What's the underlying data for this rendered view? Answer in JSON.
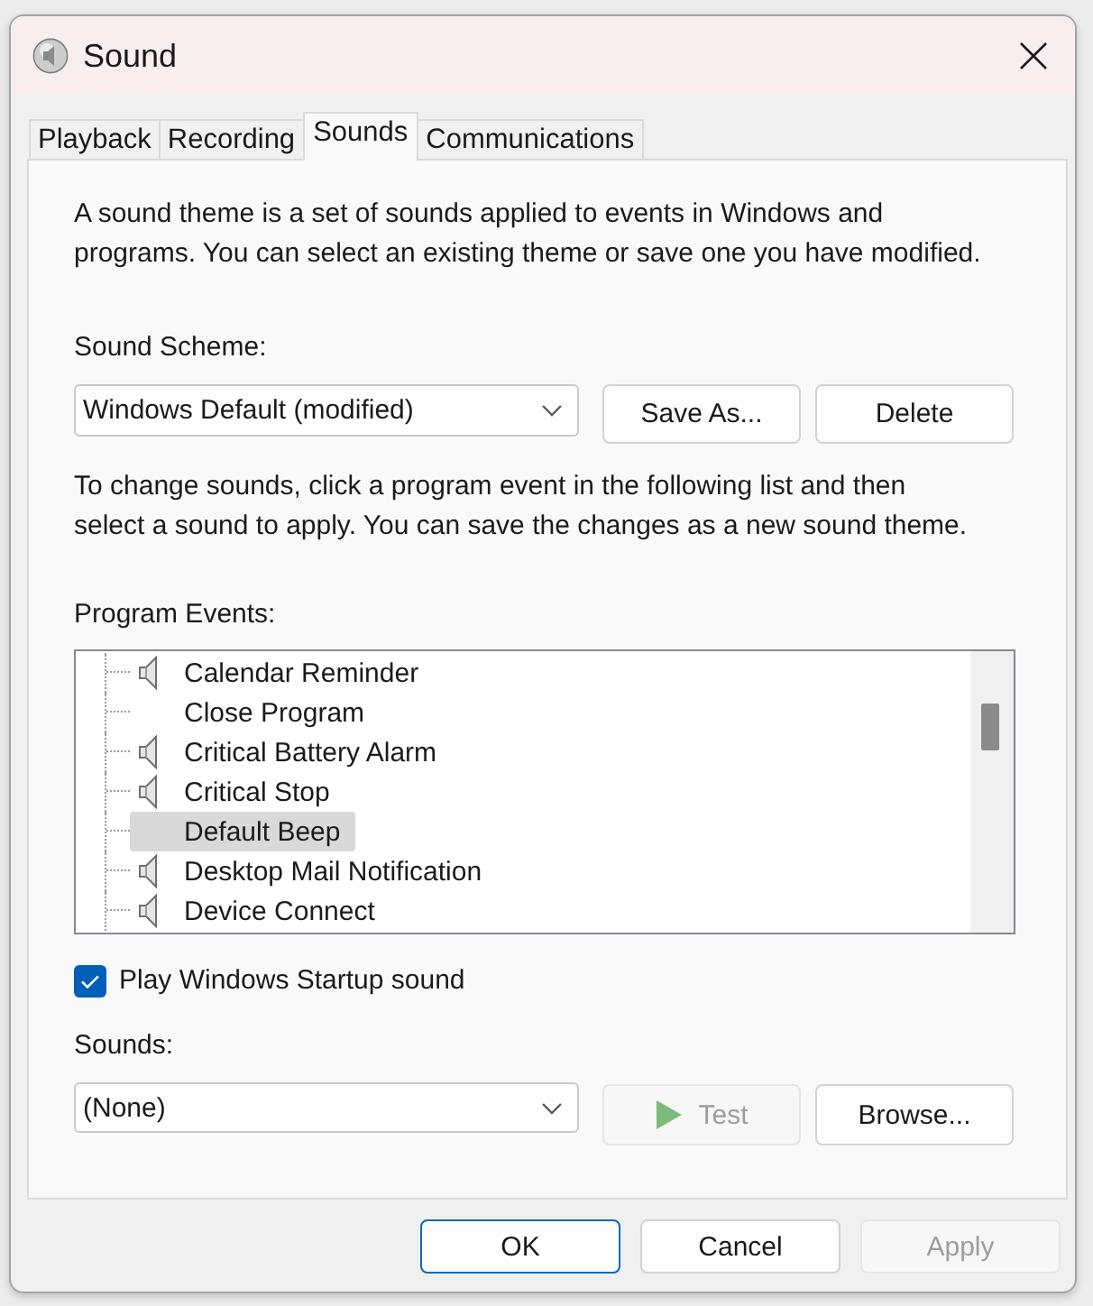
{
  "window": {
    "title": "Sound"
  },
  "tabs": [
    {
      "label": "Playback",
      "selected": false
    },
    {
      "label": "Recording",
      "selected": false
    },
    {
      "label": "Sounds",
      "selected": true
    },
    {
      "label": "Communications",
      "selected": false
    }
  ],
  "description": "A sound theme is a set of sounds applied to events in Windows and programs. You can select an existing theme or save one you have modified.",
  "sound_scheme": {
    "label": "Sound Scheme:",
    "value": "Windows Default (modified)"
  },
  "scheme_buttons": [
    {
      "label": "Save As...",
      "disabled": false
    },
    {
      "label": "Delete",
      "disabled": false
    }
  ],
  "instructions": "To change sounds, click a program event in the following list and then select a sound to apply. You can save the changes as a new sound theme.",
  "program_events": {
    "label": "Program Events:",
    "items": [
      {
        "name": "Calendar Reminder",
        "has_sound": true,
        "selected": false
      },
      {
        "name": "Close Program",
        "has_sound": false,
        "selected": false
      },
      {
        "name": "Critical Battery Alarm",
        "has_sound": true,
        "selected": false
      },
      {
        "name": "Critical Stop",
        "has_sound": true,
        "selected": false
      },
      {
        "name": "Default Beep",
        "has_sound": false,
        "selected": true
      },
      {
        "name": "Desktop Mail Notification",
        "has_sound": true,
        "selected": false
      },
      {
        "name": "Device Connect",
        "has_sound": true,
        "selected": false
      }
    ]
  },
  "startup_sound": {
    "label": "Play Windows Startup sound",
    "checked": true
  },
  "sounds": {
    "label": "Sounds:",
    "value": "(None)"
  },
  "sound_buttons": [
    {
      "kind": "play",
      "label": "Test",
      "disabled": true
    },
    {
      "kind": "plain",
      "label": "Browse...",
      "disabled": false
    }
  ],
  "buttons": [
    {
      "label": "OK",
      "default": true,
      "disabled": false
    },
    {
      "label": "Cancel",
      "default": false,
      "disabled": false
    },
    {
      "label": "Apply",
      "default": false,
      "disabled": true
    }
  ]
}
